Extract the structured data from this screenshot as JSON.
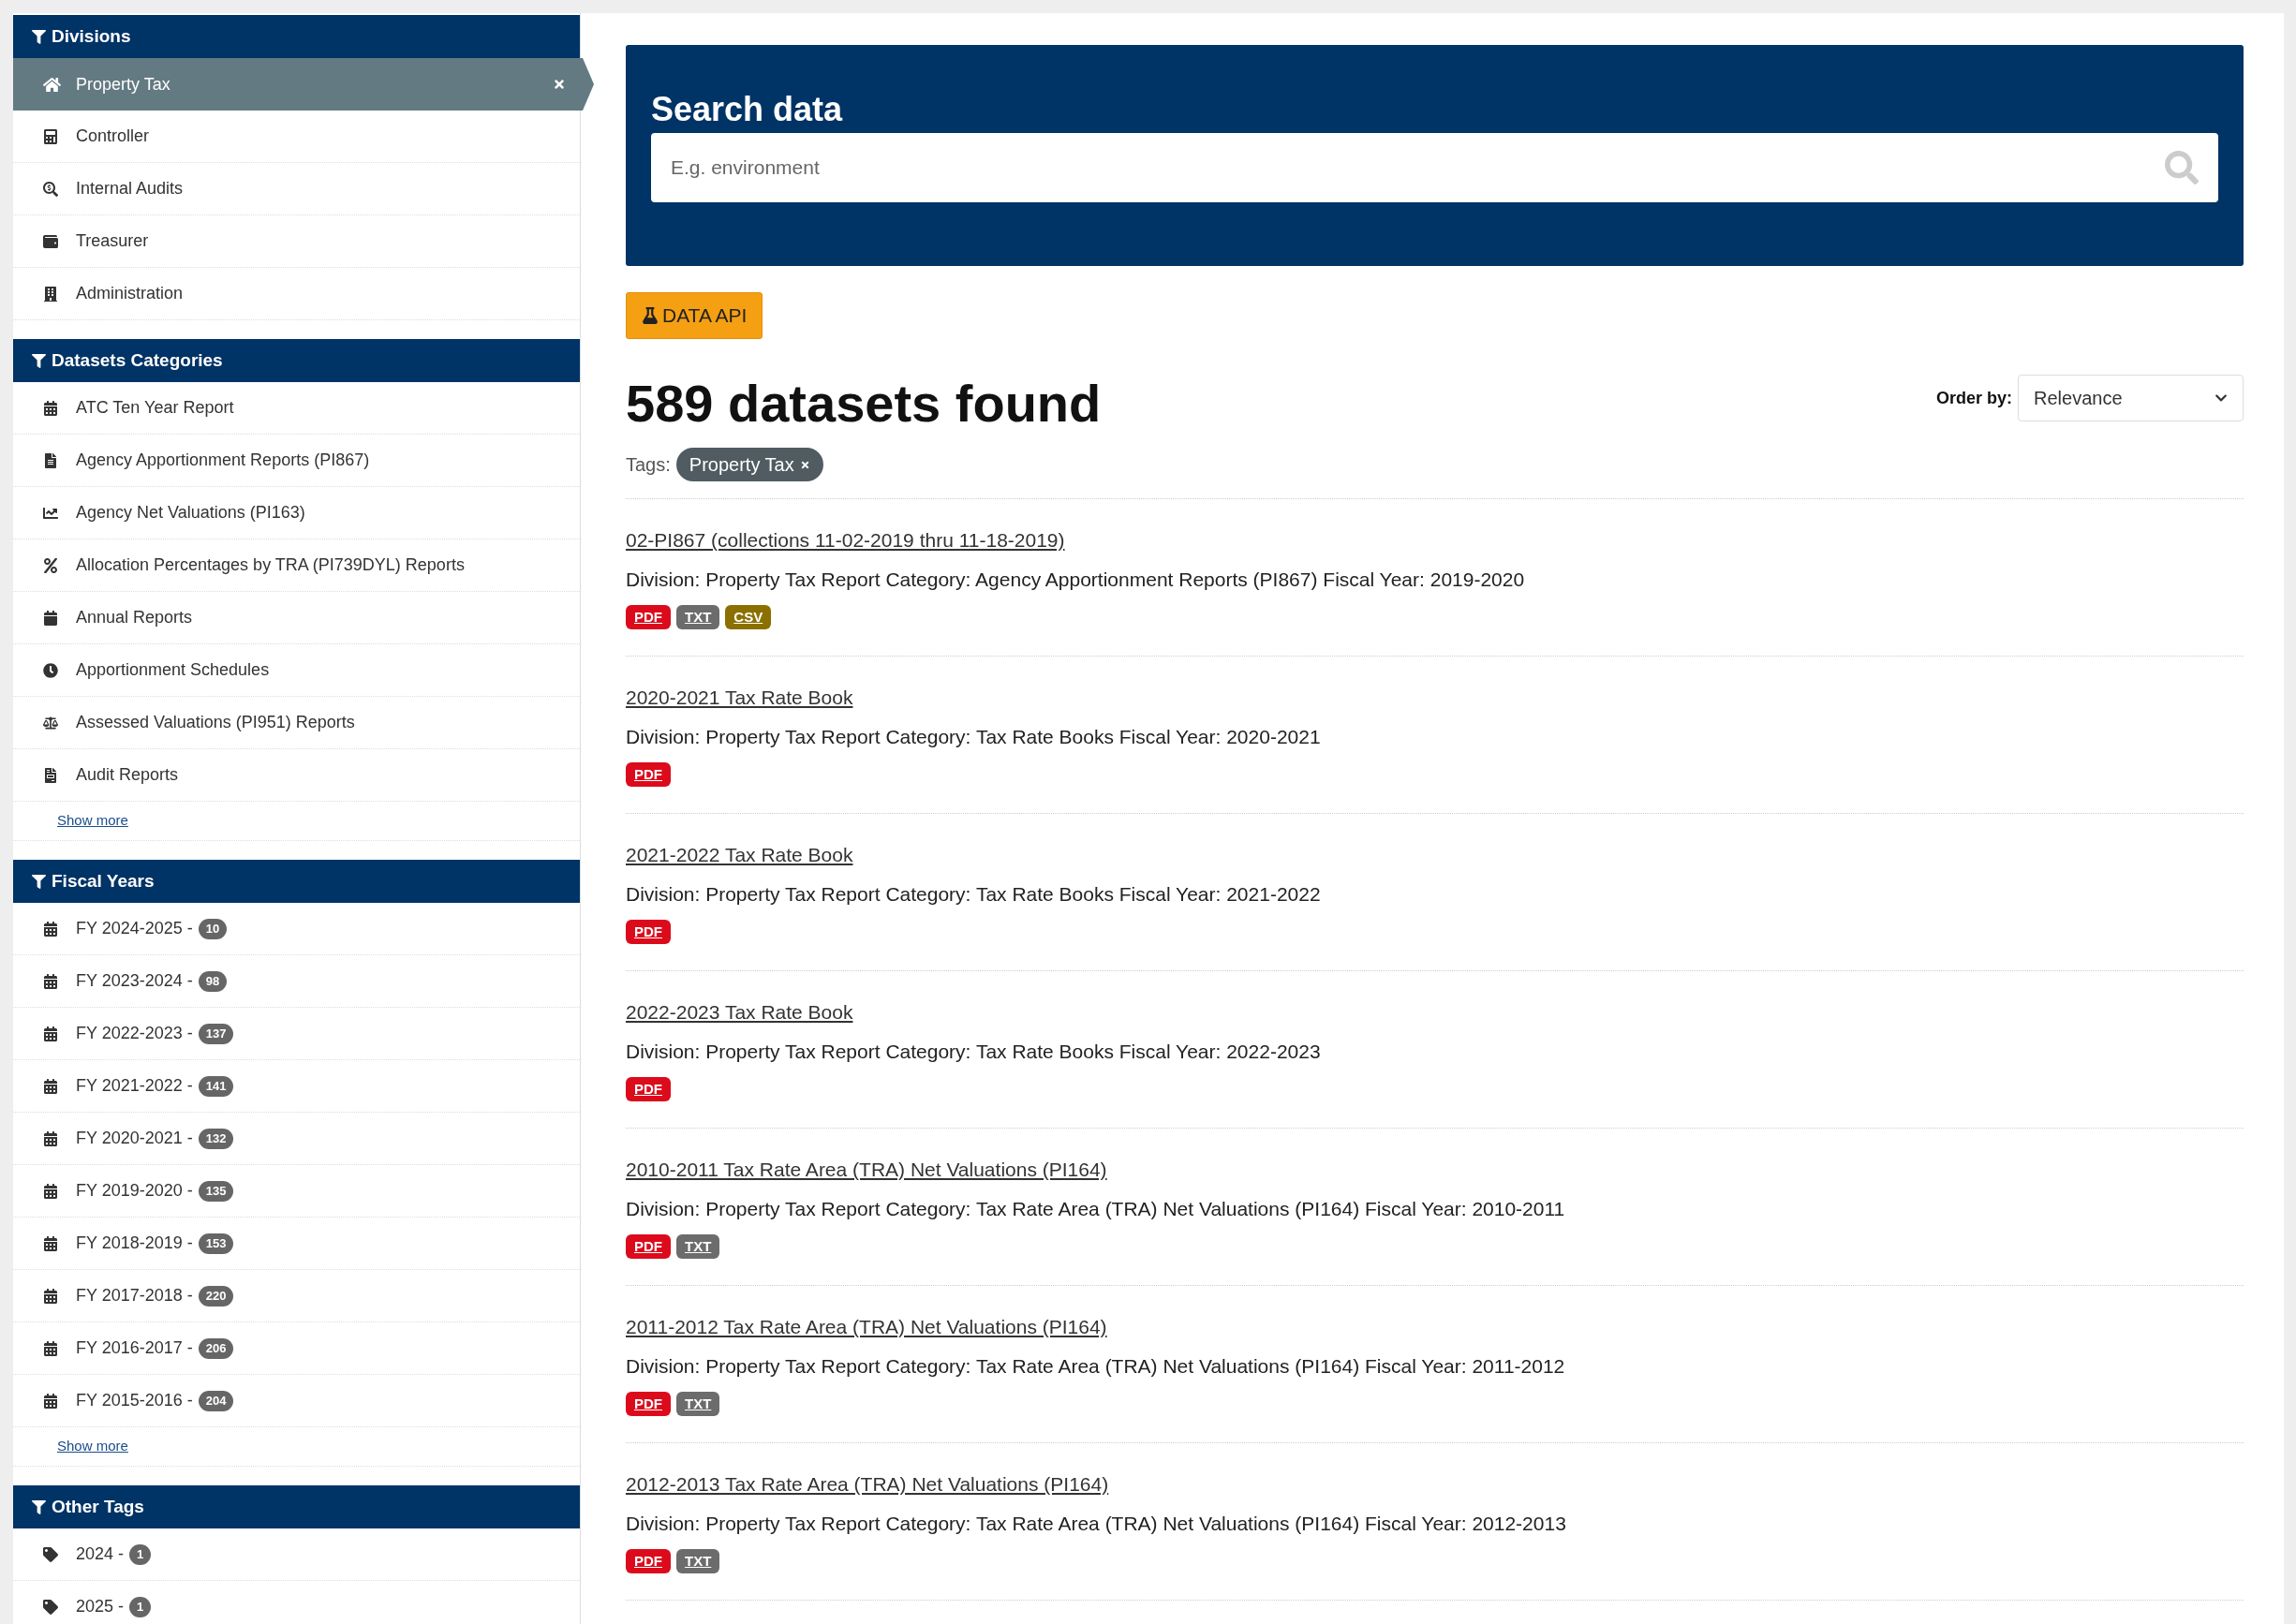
{
  "divisions": {
    "title": "Divisions",
    "items": [
      {
        "label": "Property Tax",
        "selected": true
      },
      {
        "label": "Controller",
        "selected": false
      },
      {
        "label": "Internal Audits",
        "selected": false
      },
      {
        "label": "Treasurer",
        "selected": false
      },
      {
        "label": "Administration",
        "selected": false
      }
    ]
  },
  "categories": {
    "title": "Datasets Categories",
    "items": [
      {
        "label": "ATC Ten Year Report"
      },
      {
        "label": "Agency Apportionment Reports (PI867)"
      },
      {
        "label": "Agency Net Valuations (PI163)"
      },
      {
        "label": "Allocation Percentages by TRA (PI739DYL) Reports"
      },
      {
        "label": "Annual Reports"
      },
      {
        "label": "Apportionment Schedules"
      },
      {
        "label": "Assessed Valuations (PI951) Reports"
      },
      {
        "label": "Audit Reports"
      }
    ],
    "show_more": "Show more"
  },
  "fiscal_years": {
    "title": "Fiscal Years",
    "items": [
      {
        "label": "FY 2024-2025 -",
        "count": "10"
      },
      {
        "label": "FY 2023-2024 -",
        "count": "98"
      },
      {
        "label": "FY 2022-2023 -",
        "count": "137"
      },
      {
        "label": "FY 2021-2022 -",
        "count": "141"
      },
      {
        "label": "FY 2020-2021 -",
        "count": "132"
      },
      {
        "label": "FY 2019-2020 -",
        "count": "135"
      },
      {
        "label": "FY 2018-2019 -",
        "count": "153"
      },
      {
        "label": "FY 2017-2018 -",
        "count": "220"
      },
      {
        "label": "FY 2016-2017 -",
        "count": "206"
      },
      {
        "label": "FY 2015-2016 -",
        "count": "204"
      }
    ],
    "show_more": "Show more"
  },
  "other_tags": {
    "title": "Other Tags",
    "items": [
      {
        "label": "2024 -",
        "count": "1"
      },
      {
        "label": "2025 -",
        "count": "1"
      }
    ]
  },
  "search": {
    "title": "Search data",
    "placeholder": "E.g. environment"
  },
  "api_button": "DATA API",
  "results_heading": "589 datasets found",
  "order_by": {
    "label": "Order by:",
    "value": "Relevance"
  },
  "tags": {
    "label": "Tags:",
    "items": [
      "Property Tax"
    ]
  },
  "results": [
    {
      "title": "02-PI867 (collections 11-02-2019 thru 11-18-2019)",
      "description": "Division: Property Tax Report Category: Agency Apportionment Reports (PI867) Fiscal Year: 2019-2020",
      "formats": [
        {
          "kind": "pdf",
          "label": "PDF"
        },
        {
          "kind": "txt",
          "label": "TXT"
        },
        {
          "kind": "csv",
          "label": "CSV"
        }
      ]
    },
    {
      "title": "2020-2021 Tax Rate Book",
      "description": "Division: Property Tax Report Category: Tax Rate Books Fiscal Year: 2020-2021",
      "formats": [
        {
          "kind": "pdf",
          "label": "PDF"
        }
      ]
    },
    {
      "title": "2021-2022 Tax Rate Book",
      "description": "Division: Property Tax Report Category: Tax Rate Books Fiscal Year: 2021-2022",
      "formats": [
        {
          "kind": "pdf",
          "label": "PDF"
        }
      ]
    },
    {
      "title": "2022-2023 Tax Rate Book",
      "description": "Division: Property Tax Report Category: Tax Rate Books Fiscal Year: 2022-2023",
      "formats": [
        {
          "kind": "pdf",
          "label": "PDF"
        }
      ]
    },
    {
      "title": "2010-2011 Tax Rate Area (TRA) Net Valuations (PI164)",
      "description": "Division: Property Tax Report Category: Tax Rate Area (TRA) Net Valuations (PI164) Fiscal Year: 2010-2011",
      "formats": [
        {
          "kind": "pdf",
          "label": "PDF"
        },
        {
          "kind": "txt",
          "label": "TXT"
        }
      ]
    },
    {
      "title": "2011-2012 Tax Rate Area (TRA) Net Valuations (PI164)",
      "description": "Division: Property Tax Report Category: Tax Rate Area (TRA) Net Valuations (PI164) Fiscal Year: 2011-2012",
      "formats": [
        {
          "kind": "pdf",
          "label": "PDF"
        },
        {
          "kind": "txt",
          "label": "TXT"
        }
      ]
    },
    {
      "title": "2012-2013 Tax Rate Area (TRA) Net Valuations (PI164)",
      "description": "Division: Property Tax Report Category: Tax Rate Area (TRA) Net Valuations (PI164) Fiscal Year: 2012-2013",
      "formats": [
        {
          "kind": "pdf",
          "label": "PDF"
        },
        {
          "kind": "txt",
          "label": "TXT"
        }
      ]
    }
  ]
}
